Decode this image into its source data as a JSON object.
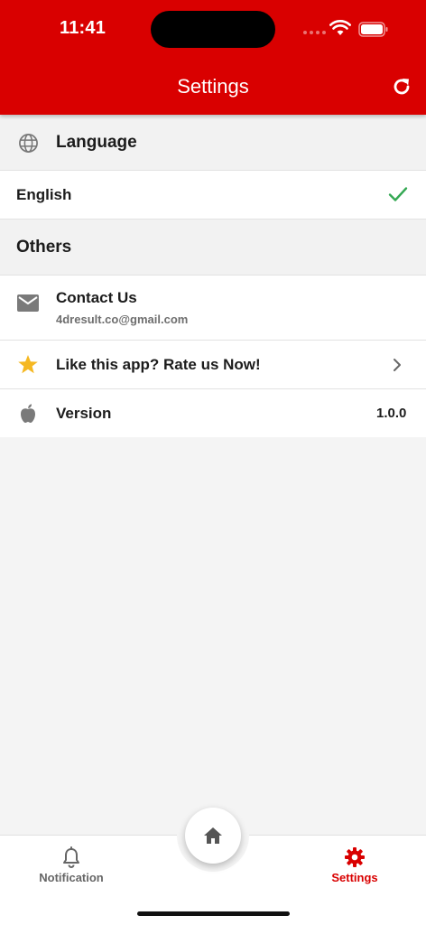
{
  "status_bar": {
    "time": "11:41"
  },
  "header": {
    "title": "Settings",
    "refresh_icon": "refresh-icon"
  },
  "language_section": {
    "title": "Language",
    "icon": "globe-icon"
  },
  "language_option": {
    "label": "English",
    "selected": true,
    "check_color": "#34a853"
  },
  "others_section": {
    "title": "Others"
  },
  "contact": {
    "label": "Contact Us",
    "email": "4dresult.co@gmail.com",
    "icon": "mail-icon"
  },
  "rate": {
    "label": "Like this app? Rate us Now!",
    "icon": "star-icon",
    "icon_color": "#f5b822"
  },
  "version": {
    "label": "Version",
    "value": "1.0.0",
    "icon": "apple-icon"
  },
  "tabbar": {
    "notification_label": "Notification",
    "settings_label": "Settings",
    "active": "settings",
    "active_color": "#d90000",
    "inactive_color": "#666666"
  },
  "colors": {
    "brand": "#d90000",
    "background": "#f4f4f4"
  }
}
